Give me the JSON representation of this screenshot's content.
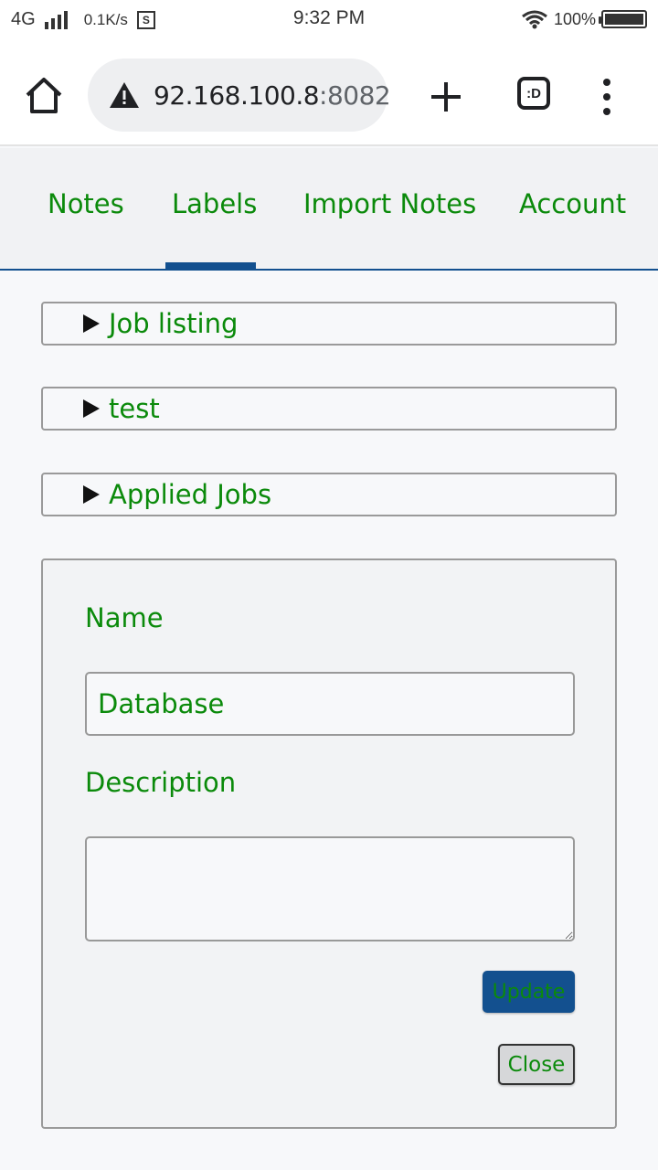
{
  "status_bar": {
    "network": "4G",
    "speed": "0.1K/s",
    "sim_icon_label": "S",
    "time": "9:32 PM",
    "battery": "100%"
  },
  "browser": {
    "url_host": "92.168.100.8",
    "url_port": ":8082",
    "tabs_icon_label": ":D",
    "icons": {
      "home": "home-icon",
      "warning": "warning-icon",
      "new_tab": "plus-icon",
      "tabs": "tabs-icon",
      "menu": "more-vert-icon"
    }
  },
  "nav": {
    "tabs": [
      {
        "label": "Notes"
      },
      {
        "label": "Labels"
      },
      {
        "label": "Import Notes"
      },
      {
        "label": "Account"
      }
    ],
    "active": "Labels"
  },
  "labels": [
    {
      "name": "Job listing"
    },
    {
      "name": "test"
    },
    {
      "name": "Applied Jobs"
    }
  ],
  "form": {
    "name_label": "Name",
    "name_value": "Database",
    "description_label": "Description",
    "description_value": "",
    "update_label": "Update",
    "close_label": "Close"
  },
  "colors": {
    "accent": "#13508f",
    "text_green": "#0b8a0b"
  }
}
